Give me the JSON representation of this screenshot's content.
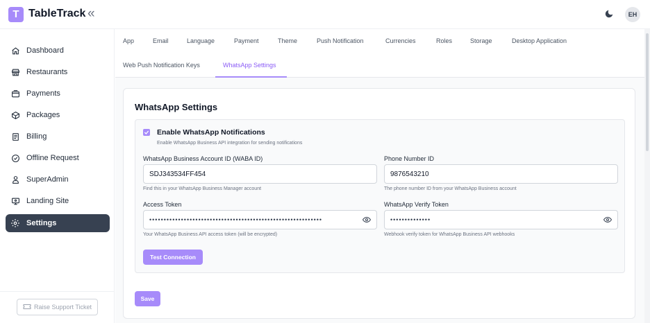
{
  "app": {
    "logo_letter": "T",
    "brand": "TableTrack",
    "collapse_icon": "«",
    "avatar_initials": "EH"
  },
  "sidebar": {
    "items": [
      {
        "label": "Dashboard",
        "icon": "home-icon"
      },
      {
        "label": "Restaurants",
        "icon": "store-icon"
      },
      {
        "label": "Payments",
        "icon": "wallet-icon"
      },
      {
        "label": "Packages",
        "icon": "box-icon"
      },
      {
        "label": "Billing",
        "icon": "document-icon"
      },
      {
        "label": "Offline Request",
        "icon": "check-circle-icon"
      },
      {
        "label": "SuperAdmin",
        "icon": "user-icon"
      },
      {
        "label": "Landing Site",
        "icon": "monitor-icon"
      },
      {
        "label": "Settings",
        "icon": "gear-icon",
        "active": true
      }
    ],
    "support_label": "Raise Support Ticket"
  },
  "tabs": {
    "row1": [
      "App",
      "Email",
      "Language",
      "Payment",
      "Theme",
      "Push Notification",
      "Currencies",
      "Roles",
      "Storage",
      "Desktop Application"
    ],
    "row2": [
      "Web Push Notification Keys",
      "WhatsApp Settings"
    ],
    "active": "WhatsApp Settings"
  },
  "whatsapp": {
    "title": "WhatsApp Settings",
    "enable_label": "Enable WhatsApp Notifications",
    "enable_desc": "Enable WhatsApp Business API integration for sending notifications",
    "enabled": true,
    "waba_label": "WhatsApp Business Account ID (WABA ID)",
    "waba_value": "SDJ343534FF454",
    "waba_help": "Find this in your WhatsApp Business Manager account",
    "phone_label": "Phone Number ID",
    "phone_value": "9876543210",
    "phone_help": "The phone number ID from your WhatsApp Business account",
    "token_label": "Access Token",
    "token_masked": "••••••••••••••••••••••••••••••••••••••••••••••••••••••••••••",
    "token_help": "Your WhatsApp Business API access token (will be encrypted)",
    "verify_label": "WhatsApp Verify Token",
    "verify_masked": "••••••••••••••",
    "verify_help": "Webhook verify token for WhatsApp Business API webhooks",
    "test_button": "Test Connection",
    "save_button": "Save"
  },
  "colors": {
    "accent": "#a78bfa",
    "active_tab": "#8b5cf6",
    "sidebar_active": "#374151"
  }
}
